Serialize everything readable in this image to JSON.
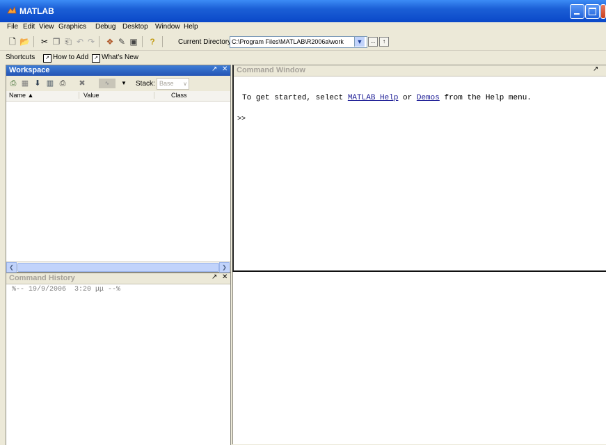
{
  "window": {
    "title": "MATLAB"
  },
  "menu": [
    "File",
    "Edit",
    "View",
    "Graphics",
    "Debug",
    "Desktop",
    "Window",
    "Help"
  ],
  "toolbar": {
    "current_directory_label": "Current Directory:",
    "current_directory_value": "C:\\Program Files\\MATLAB\\R2006a\\work",
    "browse_label": "...",
    "help_icon": "?"
  },
  "shortcuts": {
    "label": "Shortcuts",
    "how_to_add": "How to Add",
    "whats_new": "What's New"
  },
  "workspace": {
    "title": "Workspace",
    "stack_label": "Stack:",
    "stack_value": "Base",
    "columns": [
      "Name ▲",
      "Value",
      "Class"
    ]
  },
  "command_window": {
    "title": "Command Window",
    "intro_before": "To get started, select ",
    "help_link": "MATLAB Help",
    "intro_middle": " or ",
    "demos_link": "Demos",
    "intro_after": " from the Help menu.",
    "prompt": ">>"
  },
  "command_history": {
    "title": "Command History",
    "entries": [
      "%-- 19/9/2006  3:20 μμ --%"
    ]
  },
  "pane_controls": {
    "undock": "↗",
    "close": "✕"
  },
  "colors": {
    "titlebar": "#0a48c8",
    "active_pane_header": "#2354b4",
    "link": "#1d1d96"
  }
}
